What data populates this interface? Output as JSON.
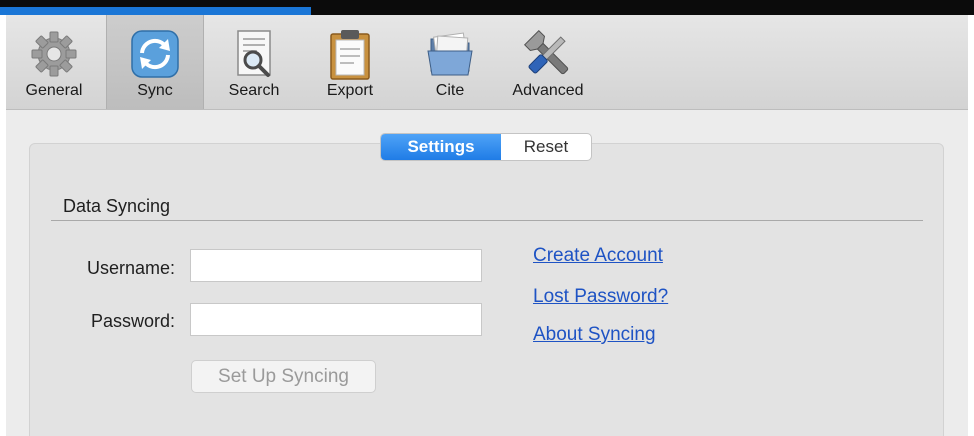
{
  "toolbar": {
    "items": [
      {
        "label": "General",
        "icon": "gear-icon"
      },
      {
        "label": "Sync",
        "icon": "sync-icon",
        "selected": true
      },
      {
        "label": "Search",
        "icon": "search-document-icon"
      },
      {
        "label": "Export",
        "icon": "clipboard-icon"
      },
      {
        "label": "Cite",
        "icon": "folder-icon"
      },
      {
        "label": "Advanced",
        "icon": "tools-icon"
      }
    ]
  },
  "tabs": {
    "settings": "Settings",
    "reset": "Reset",
    "active": "Settings"
  },
  "data_syncing": {
    "title": "Data Syncing",
    "username_label": "Username:",
    "username_value": "",
    "password_label": "Password:",
    "password_value": "",
    "setup_button": "Set Up Syncing",
    "links": {
      "create_account": "Create Account",
      "lost_password": "Lost Password?",
      "about_syncing": "About Syncing"
    }
  },
  "colors": {
    "accent": "#1f7ce6",
    "link": "#1e53c4",
    "progress": "#1a76d6"
  }
}
